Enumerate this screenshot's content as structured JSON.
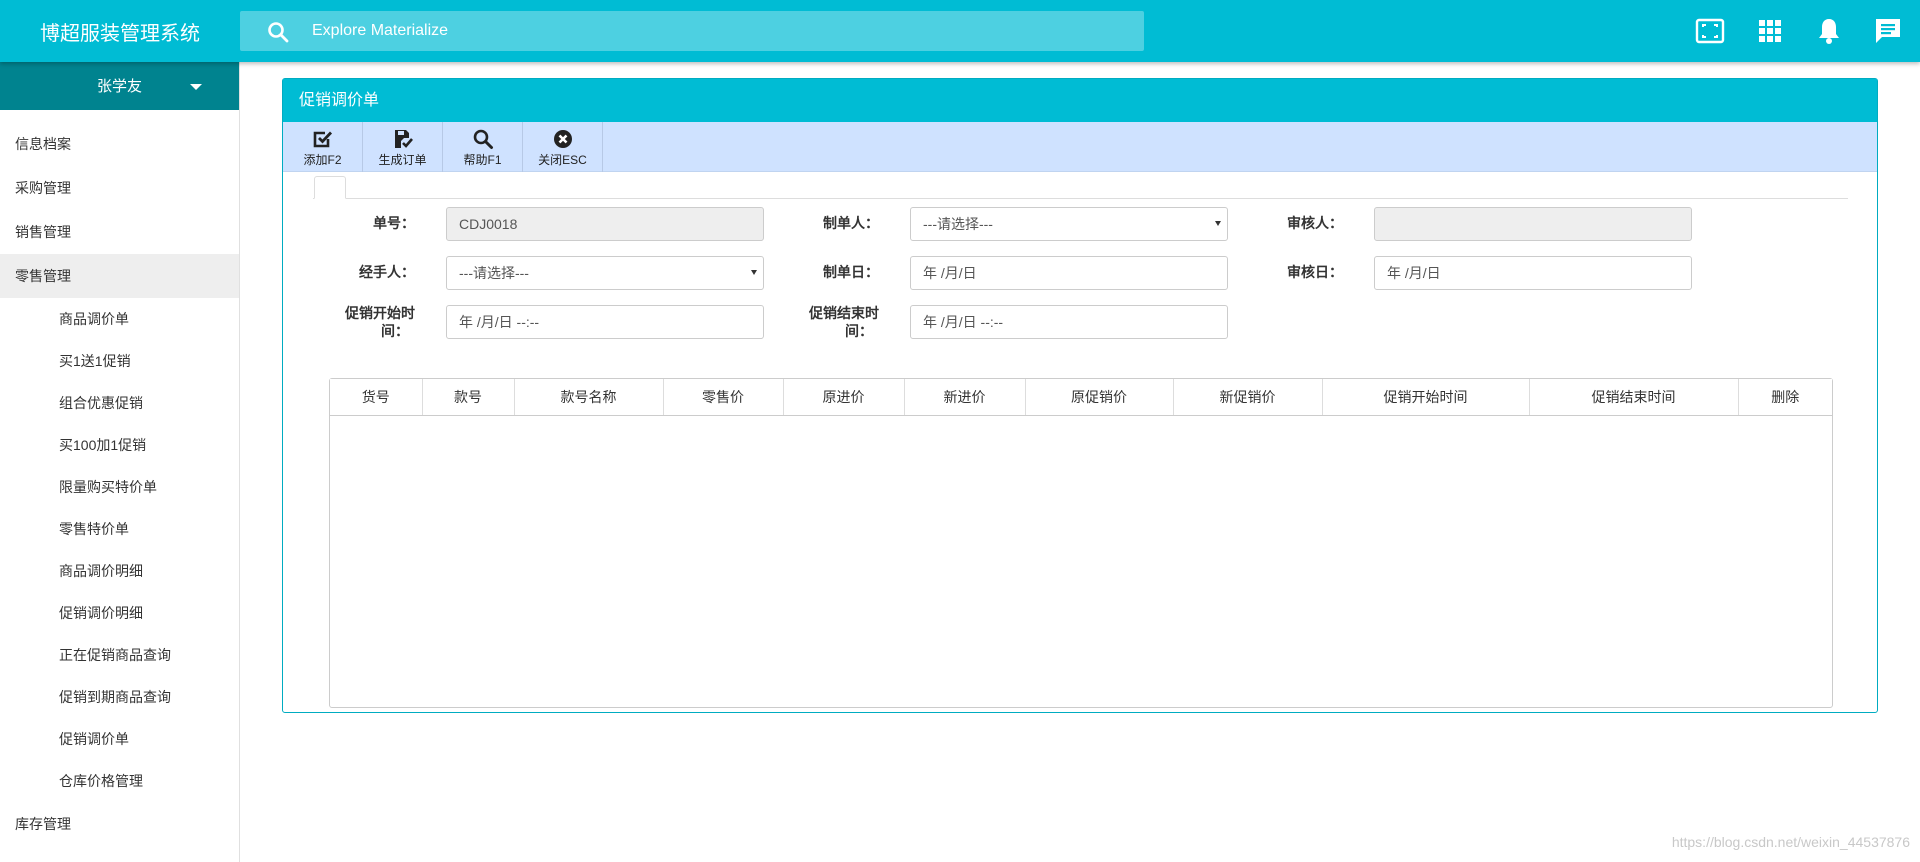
{
  "header": {
    "app_title": "博超服装管理系统",
    "search_placeholder": "Explore Materialize",
    "icons": [
      "fullscreen-icon",
      "apps-icon",
      "notifications-icon",
      "chat-icon"
    ]
  },
  "sidebar": {
    "user_name": "张学友",
    "menu": [
      {
        "label": "信息档案"
      },
      {
        "label": "采购管理"
      },
      {
        "label": "销售管理"
      },
      {
        "label": "零售管理",
        "active": true
      }
    ],
    "submenu": [
      {
        "label": "商品调价单"
      },
      {
        "label": "买1送1促销"
      },
      {
        "label": "组合优惠促销"
      },
      {
        "label": "买100加1促销"
      },
      {
        "label": "限量购买特价单"
      },
      {
        "label": "零售特价单"
      },
      {
        "label": "商品调价明细"
      },
      {
        "label": "促销调价明细"
      },
      {
        "label": "正在促销商品查询"
      },
      {
        "label": "促销到期商品查询"
      },
      {
        "label": "促销调价单"
      },
      {
        "label": "仓库价格管理"
      }
    ],
    "menu_after": [
      {
        "label": "库存管理"
      }
    ]
  },
  "panel": {
    "title": "促销调价单",
    "toolbar": [
      {
        "label": "添加F2",
        "icon": "check-square-icon"
      },
      {
        "label": "生成订单",
        "icon": "save-check-icon"
      },
      {
        "label": "帮助F1",
        "icon": "search-icon"
      },
      {
        "label": "关闭ESC",
        "icon": "close-circle-icon"
      }
    ],
    "form": {
      "order_no_label": "单号：",
      "order_no_value": "CDJ0018",
      "creator_label": "制单人：",
      "creator_value": "---请选择---",
      "reviewer_label": "审核人：",
      "reviewer_value": "",
      "handler_label": "经手人：",
      "handler_value": "---请选择---",
      "create_date_label": "制单日：",
      "create_date_value": "年 /月/日",
      "review_date_label": "审核日：",
      "review_date_value": "年 /月/日",
      "promo_start_label_1": "促销开始时",
      "promo_start_label_2": "间：",
      "promo_start_value": "年 /月/日 --:--",
      "promo_end_label_1": "促销结束时",
      "promo_end_label_2": "间：",
      "promo_end_value": "年 /月/日 --:--"
    },
    "table": {
      "columns": [
        "货号",
        "款号",
        "款号名称",
        "零售价",
        "原进价",
        "新进价",
        "原促销价",
        "新促销价",
        "促销开始时间",
        "促销结束时间",
        "删除"
      ],
      "rows": []
    }
  },
  "watermark": "https://blog.csdn.net/weixin_44537876"
}
